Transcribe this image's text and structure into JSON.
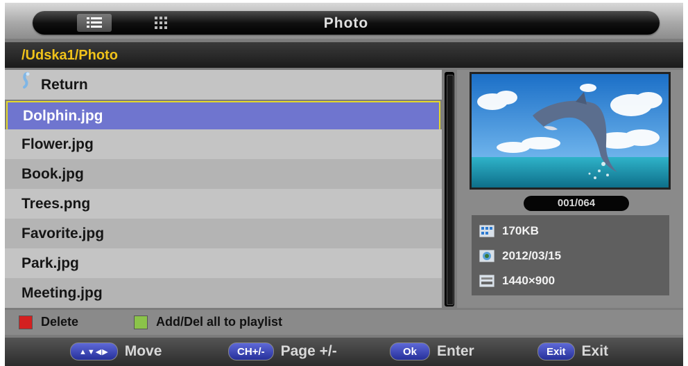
{
  "header": {
    "title": "Photo",
    "view_list_icon": "list-view-icon",
    "view_grid_icon": "grid-view-icon"
  },
  "path": "/Udska1/Photo",
  "files": {
    "return_label": "Return",
    "items": [
      {
        "name": "Dolphin.jpg",
        "selected": true
      },
      {
        "name": "Flower.jpg"
      },
      {
        "name": "Book.jpg"
      },
      {
        "name": "Trees.png"
      },
      {
        "name": "Favorite.jpg"
      },
      {
        "name": "Park.jpg"
      },
      {
        "name": "Meeting.jpg"
      }
    ]
  },
  "preview": {
    "counter": "001/064",
    "size": "170KB",
    "date": "2012/03/15",
    "resolution": "1440×900"
  },
  "legend": {
    "delete_label": "Delete",
    "delete_color": "#d42020",
    "playlist_label": "Add/Del all to playlist",
    "playlist_color": "#8bc34a"
  },
  "hints": {
    "move_key": "▲▼◀▶",
    "move_label": "Move",
    "page_key": "CH+/-",
    "page_label": "Page +/-",
    "ok_key": "Ok",
    "ok_label": "Enter",
    "exit_key": "Exit",
    "exit_label": "Exit"
  }
}
